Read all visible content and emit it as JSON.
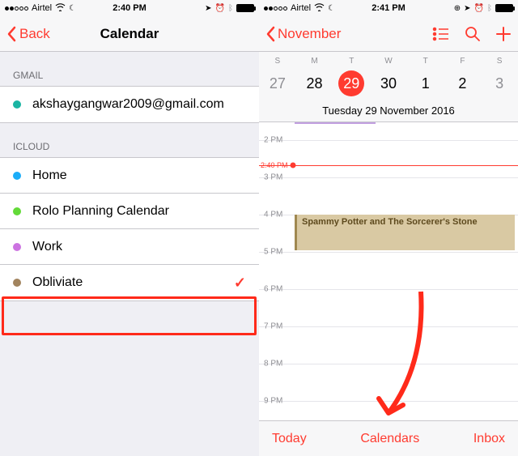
{
  "left": {
    "status": {
      "carrier": "Airtel",
      "time": "2:40 PM"
    },
    "nav": {
      "back": "Back",
      "title": "Calendar"
    },
    "sections": [
      {
        "header": "GMAIL",
        "items": [
          {
            "color": "#1bb5a3",
            "label": "akshaygangwar2009@gmail.com",
            "checked": false
          }
        ]
      },
      {
        "header": "ICLOUD",
        "items": [
          {
            "color": "#1badf8",
            "label": "Home",
            "checked": false
          },
          {
            "color": "#63da38",
            "label": "Rolo Planning Calendar",
            "checked": false
          },
          {
            "color": "#cc73e1",
            "label": "Work",
            "checked": false
          },
          {
            "color": "#a2845e",
            "label": "Obliviate",
            "checked": true
          }
        ]
      }
    ]
  },
  "right": {
    "status": {
      "carrier": "Airtel",
      "time": "2:41 PM"
    },
    "nav": {
      "month": "November"
    },
    "weekdays": [
      "S",
      "M",
      "T",
      "W",
      "T",
      "F",
      "S"
    ],
    "days": [
      {
        "n": "27",
        "dim": true
      },
      {
        "n": "28"
      },
      {
        "n": "29",
        "selected": true
      },
      {
        "n": "30"
      },
      {
        "n": "1"
      },
      {
        "n": "2"
      },
      {
        "n": "3",
        "dim": true
      }
    ],
    "date_label": "Tuesday   29 November 2016",
    "now": "2:40 PM",
    "hours": [
      "2 PM",
      "3 PM",
      "4 PM",
      "5 PM",
      "6 PM",
      "7 PM",
      "8 PM",
      "9 PM"
    ],
    "event": {
      "title": "Spammy Potter and The Sorcerer's Stone"
    },
    "toolbar": {
      "today": "Today",
      "calendars": "Calendars",
      "inbox": "Inbox"
    }
  }
}
